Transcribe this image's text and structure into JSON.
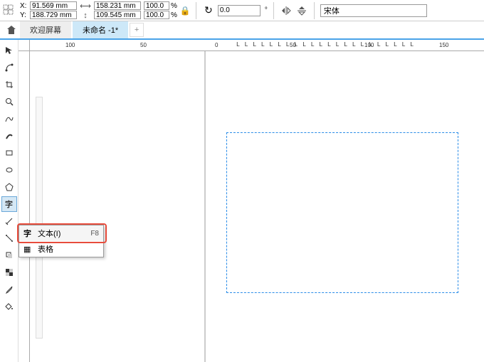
{
  "property_bar": {
    "x_label": "X:",
    "y_label": "Y:",
    "x_value": "91.569 mm",
    "y_value": "188.729 mm",
    "w_value": "158.231 mm",
    "h_value": "109.545 mm",
    "pct_w": "100.0",
    "pct_h": "100.0",
    "pct_unit": "%",
    "rotation": "0.0",
    "degree": "°",
    "font_name": "宋体"
  },
  "tabs": {
    "welcome": "欢迎屏幕",
    "untitled": "未命名 -1*",
    "add": "+"
  },
  "ruler": {
    "t100n": "100",
    "t50n": "50",
    "t0": "0",
    "t50": "50",
    "t100": "100",
    "t150": "150"
  },
  "flyout": {
    "text_label": "文本(I)",
    "text_sc": "F8",
    "text_icon": "字",
    "table_label": "表格",
    "table_icon": "▦"
  },
  "tools": {
    "text": "字"
  }
}
